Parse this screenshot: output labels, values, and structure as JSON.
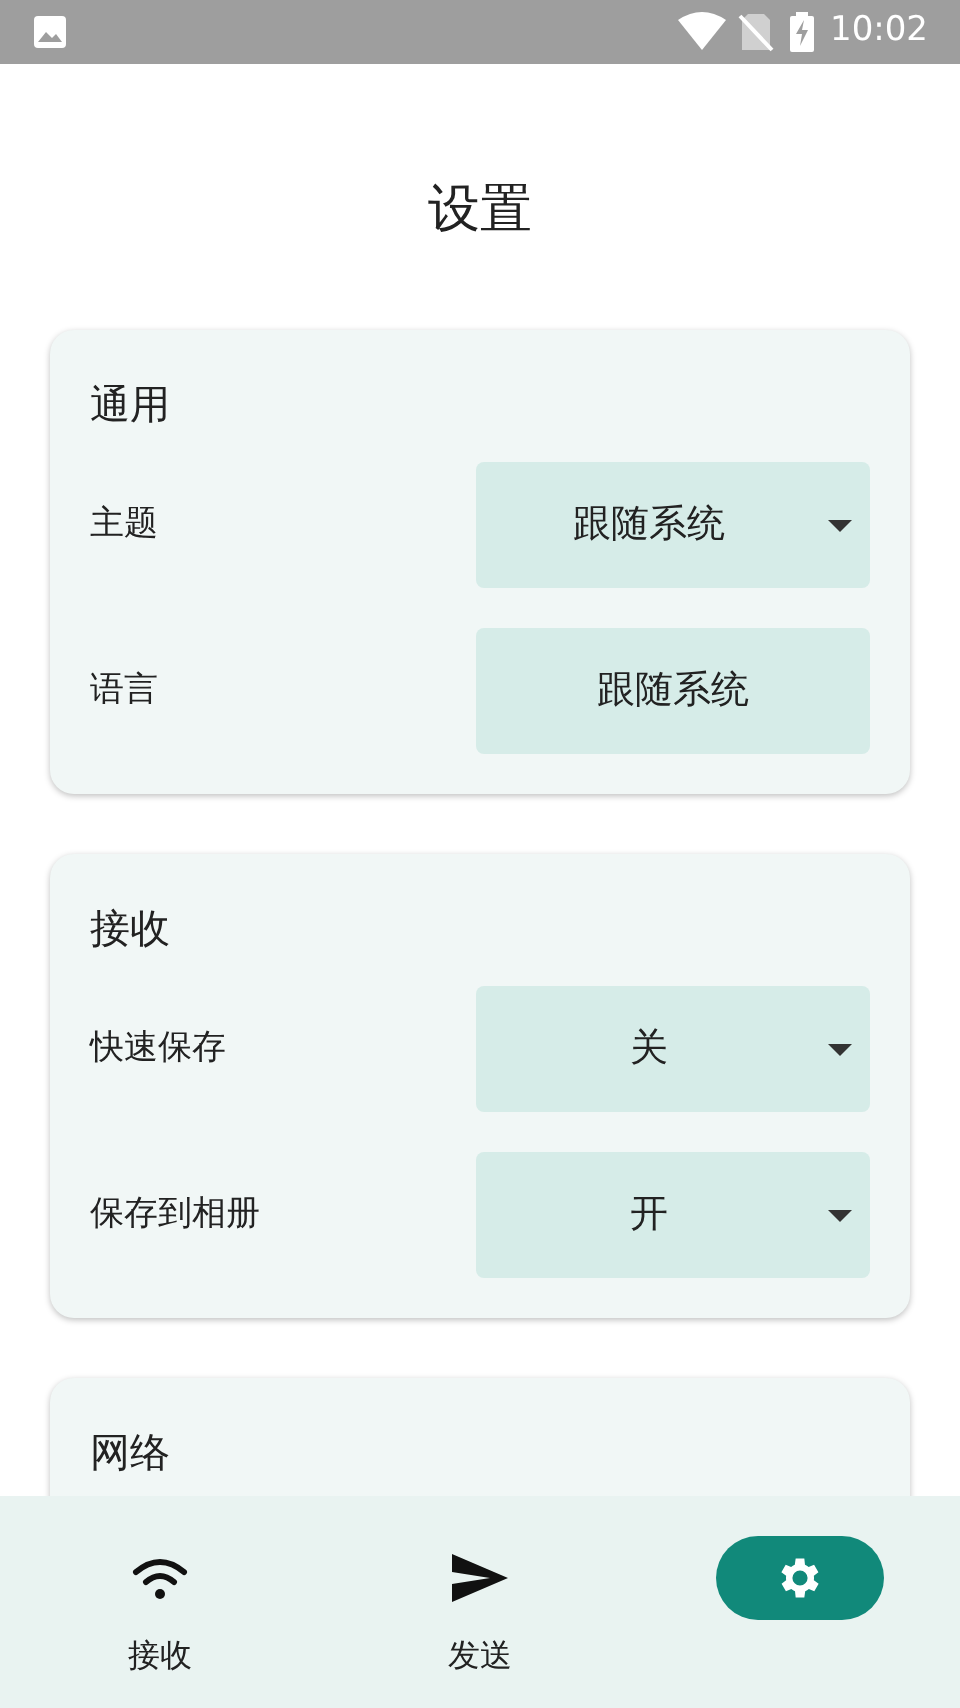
{
  "status_bar": {
    "time": "10:02"
  },
  "title": "设置",
  "sections": [
    {
      "title": "通用",
      "rows": [
        {
          "label": "主题",
          "value": "跟随系统",
          "dropdown": true
        },
        {
          "label": "语言",
          "value": "跟随系统",
          "dropdown": false
        }
      ]
    },
    {
      "title": "接收",
      "rows": [
        {
          "label": "快速保存",
          "value": "关",
          "dropdown": true
        },
        {
          "label": "保存到相册",
          "value": "开",
          "dropdown": true
        }
      ]
    },
    {
      "title": "网络"
    }
  ],
  "nav": [
    {
      "kind": "receive",
      "label": "接收",
      "selected": false
    },
    {
      "kind": "send",
      "label": "发送",
      "selected": false
    },
    {
      "kind": "settings",
      "selected": true
    }
  ]
}
